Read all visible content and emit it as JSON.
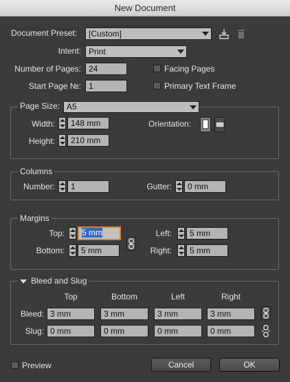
{
  "window": {
    "title": "New Document"
  },
  "header": {
    "preset_label": "Document Preset:",
    "preset_value": "[Custom]",
    "intent_label": "Intent:",
    "intent_value": "Print",
    "pages_label": "Number of Pages:",
    "pages_value": "24",
    "start_label": "Start Page №:",
    "start_value": "1",
    "facing_label": "Facing Pages",
    "primary_label": "Primary Text Frame"
  },
  "page_size": {
    "label": "Page Size:",
    "value": "A5",
    "width_label": "Width:",
    "width_value": "148 mm",
    "height_label": "Height:",
    "height_value": "210 mm",
    "orientation_label": "Orientation:"
  },
  "columns": {
    "title": "Columns",
    "number_label": "Number:",
    "number_value": "1",
    "gutter_label": "Gutter:",
    "gutter_value": "0 mm"
  },
  "margins": {
    "title": "Margins",
    "top_label": "Top:",
    "top_value": "5 mm",
    "bottom_label": "Bottom:",
    "bottom_value": "5 mm",
    "left_label": "Left:",
    "left_value": "5 mm",
    "right_label": "Right:",
    "right_value": "5 mm"
  },
  "bleed": {
    "title": "Bleed and Slug",
    "headers": [
      "Top",
      "Bottom",
      "Left",
      "Right"
    ],
    "bleed_label": "Bleed:",
    "bleed_values": [
      "3 mm",
      "3 mm",
      "3 mm",
      "3 mm"
    ],
    "slug_label": "Slug:",
    "slug_values": [
      "0 mm",
      "0 mm",
      "0 mm",
      "0 mm"
    ]
  },
  "footer": {
    "preview_label": "Preview",
    "cancel_label": "Cancel",
    "ok_label": "OK"
  },
  "icons": {
    "save_preset": "save-preset-icon",
    "delete_preset": "trash-icon",
    "portrait": "portrait-orientation-icon",
    "landscape": "landscape-orientation-icon",
    "link": "chain-link-icon",
    "unlink": "broken-link-icon",
    "collapse": "disclosure-triangle-icon"
  },
  "colors": {
    "background": "#3b3b3b",
    "field": "#b4b4b4",
    "focus": "#c98a3e",
    "selection": "#2f69c7"
  }
}
